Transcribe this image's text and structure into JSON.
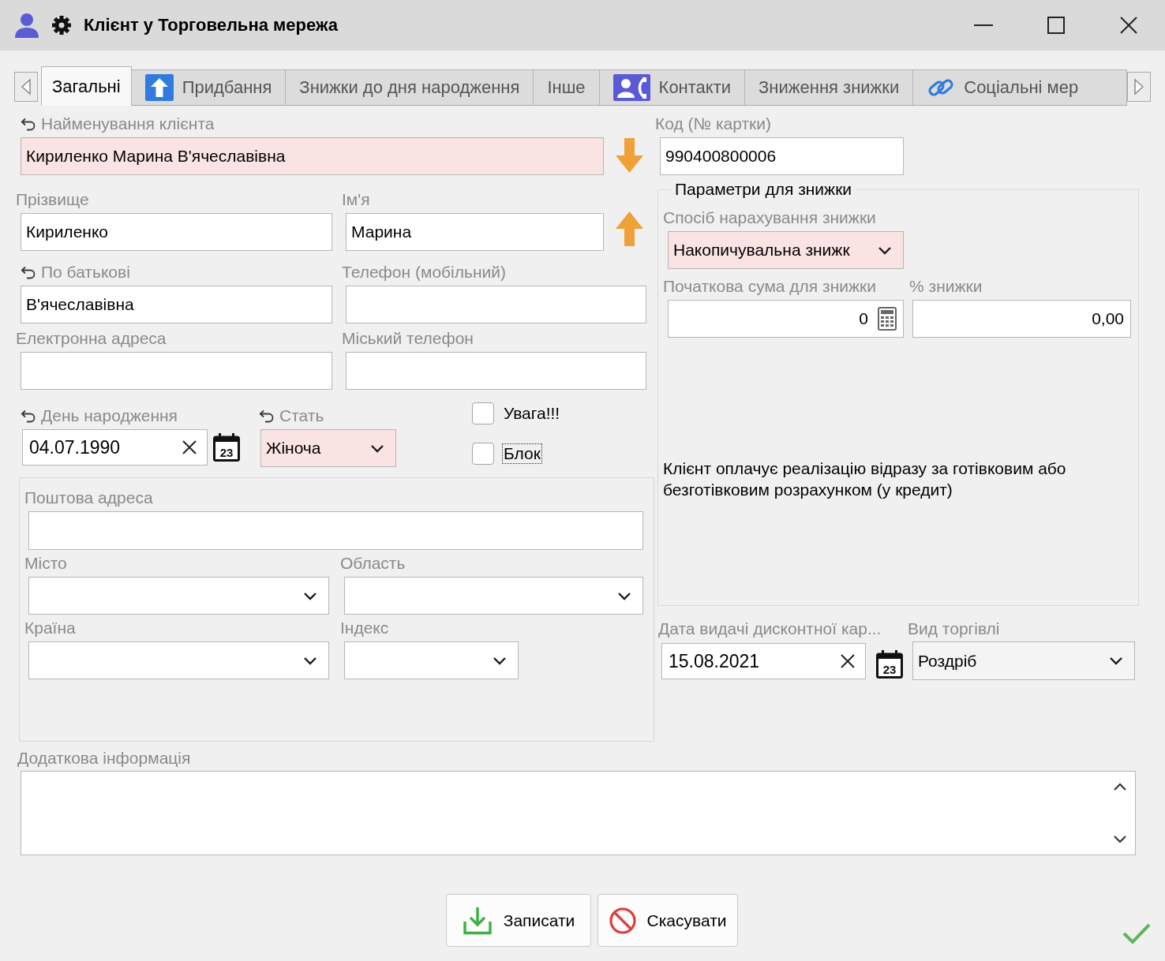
{
  "window": {
    "title": "Клієнт у Торговельна мережа"
  },
  "tabs": [
    {
      "label": "Загальні",
      "kind": "plain",
      "selected": true
    },
    {
      "label": "Придбання",
      "kind": "upload",
      "selected": false
    },
    {
      "label": "Знижки до дня народження",
      "kind": "plain",
      "selected": false
    },
    {
      "label": "Інше",
      "kind": "plain",
      "selected": false
    },
    {
      "label": "Контакти",
      "kind": "contacts",
      "selected": false
    },
    {
      "label": "Зниження знижки",
      "kind": "plain",
      "selected": false
    },
    {
      "label": "Соціальні мер",
      "kind": "link",
      "selected": false
    }
  ],
  "client_name": {
    "label": "Найменування клієнта",
    "value": "Кириленко Марина В'ячеславівна",
    "highlighted": true,
    "undo": true
  },
  "surname": {
    "label": "Прізвище",
    "value": "Кириленко"
  },
  "first_name": {
    "label": "Ім'я",
    "value": "Марина"
  },
  "patronymic": {
    "label": "По батькові",
    "value": "В'ячеславівна",
    "undo": true
  },
  "mobile_phone": {
    "label": "Телефон (мобільний)"
  },
  "email": {
    "label": "Електронна адреса"
  },
  "landline_phone": {
    "label": "Міський телефон"
  },
  "birthday": {
    "label": "День народження",
    "value": "04.07.1990",
    "calendar_day": "23",
    "undo": true
  },
  "gender": {
    "label": "Стать",
    "value": "Жіноча",
    "highlighted": true,
    "undo": true
  },
  "flags": [
    {
      "label": "Увага!!!",
      "checked": false,
      "focused": false
    },
    {
      "label": "Блок",
      "checked": false,
      "focused": true
    }
  ],
  "postal": {
    "address": {
      "label": "Поштова адреса"
    },
    "city": {
      "label": "Місто"
    },
    "region": {
      "label": "Область"
    },
    "country": {
      "label": "Країна"
    },
    "index": {
      "label": "Індекс"
    }
  },
  "card_code": {
    "label": "Код (№ картки)",
    "value": "990400800006"
  },
  "discount": {
    "title": "Параметри для знижки",
    "method": {
      "label": "Спосіб нарахування знижки",
      "value": "Накопичувальна знижк",
      "highlighted": true
    },
    "start_sum": {
      "label": "Початкова сума для знижки",
      "value": "0"
    },
    "percent": {
      "label": "% знижки",
      "value": "0,00"
    },
    "note": "Клієнт оплачує реалізацію відразу за готівковим або безготівковим розрахунком (у кредит)"
  },
  "card_issue_date": {
    "label": "Дата видачі дисконтної кар...",
    "value": "15.08.2021",
    "calendar_day": "23"
  },
  "trade_type": {
    "label": "Вид торгівлі",
    "value": "Роздріб"
  },
  "additional_info": {
    "label": "Додаткова інформація"
  },
  "buttons": [
    {
      "label": "Записати",
      "kind": "save"
    },
    {
      "label": "Скасувати",
      "kind": "cancel"
    }
  ]
}
